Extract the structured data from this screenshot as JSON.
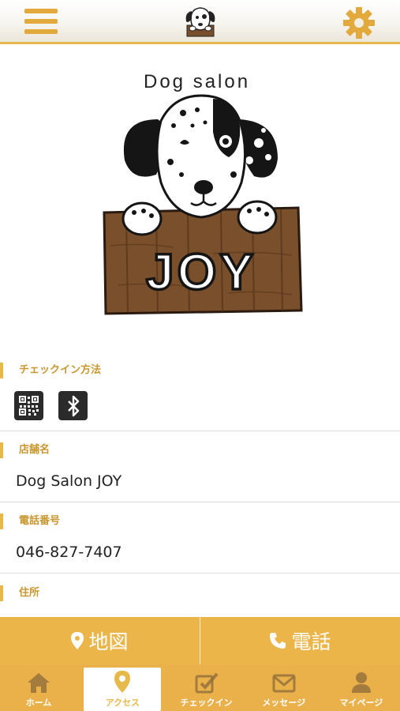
{
  "header": {
    "menu_icon": "hamburger-icon",
    "logo_icon": "dog-logo-icon",
    "settings_icon": "gear-icon"
  },
  "logo": {
    "top_text": "Dog salon",
    "board_text": "JOY"
  },
  "checkin": {
    "title": "チェックイン方法",
    "methods": [
      "qr-code-icon",
      "bluetooth-icon"
    ]
  },
  "shop": {
    "title": "店舗名",
    "value": "Dog Salon JOY"
  },
  "phone": {
    "title": "電話番号",
    "value": "046-827-7407"
  },
  "address": {
    "title": "住所"
  },
  "actions": {
    "map_label": "地図",
    "call_label": "電話"
  },
  "tabs": [
    {
      "label": "ホーム",
      "icon": "home-icon"
    },
    {
      "label": "アクセス",
      "icon": "location-pin-icon"
    },
    {
      "label": "チェックイン",
      "icon": "checkin-icon"
    },
    {
      "label": "メッセージ",
      "icon": "envelope-icon"
    },
    {
      "label": "マイページ",
      "icon": "user-icon"
    }
  ],
  "colors": {
    "accent": "#ecb54a",
    "accent_text": "#c9972f",
    "board": "#7a4f2b"
  }
}
